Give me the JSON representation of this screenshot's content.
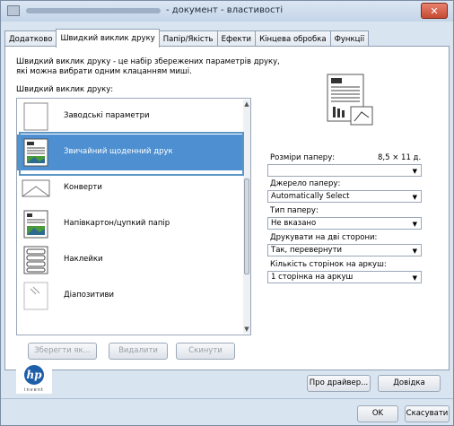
{
  "window": {
    "title": "- документ - властивості",
    "close_glyph": "✕"
  },
  "tabs": [
    "Додатково",
    "Швидкий виклик друку",
    "Папір/Якість",
    "Ефекти",
    "Кінцева обробка",
    "Функції"
  ],
  "active_tab": "Швидкий виклик друку",
  "description": "Швидкий виклик друку - це набір збережених параметрів друку, які можна вибрати одним клацанням миші.",
  "list_label": "Швидкий виклик друку:",
  "shortcuts": [
    {
      "label": "Заводські параметри",
      "icon": "blank-page-icon"
    },
    {
      "label": "Звичайний щоденний друк",
      "icon": "everyday-print-icon",
      "selected": true
    },
    {
      "label": "Конверти",
      "icon": "envelope-icon"
    },
    {
      "label": "Напівкартон/цупкий папір",
      "icon": "cardstock-icon"
    },
    {
      "label": "Наклейки",
      "icon": "labels-icon"
    },
    {
      "label": "Діапозитиви",
      "icon": "transparency-icon"
    }
  ],
  "buttons": {
    "save_as": "Зберегти як...",
    "delete": "Видалити",
    "reset": "Скинути"
  },
  "fields": {
    "paper_size": {
      "label": "Розміри паперу:",
      "dimension": "8,5 × 11 д.",
      "value": ""
    },
    "paper_source": {
      "label": "Джерело паперу:",
      "value": "Automatically Select"
    },
    "paper_type": {
      "label": "Тип паперу:",
      "value": "Не вказано"
    },
    "duplex": {
      "label": "Друкувати на дві сторони:",
      "value": "Так, перевернути"
    },
    "pages_per_sheet": {
      "label": "Кількість сторінок на аркуш:",
      "value": "1 сторінка на аркуш"
    }
  },
  "footer": {
    "about": "Про драйвер...",
    "help": "Довідка",
    "ok": "OK",
    "cancel": "Скасувати"
  },
  "logo": {
    "brand": "hp",
    "tagline": "invent"
  }
}
